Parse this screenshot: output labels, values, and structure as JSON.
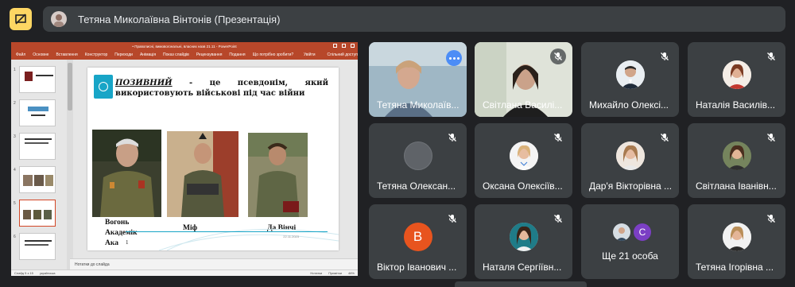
{
  "header": {
    "title": "Тетяна Миколаївна Вінтонів (Презентація)"
  },
  "presentation": {
    "window_title": "• Правописні, вимовогональні, власних назв 21.11 - PowerPoint",
    "ribbon_tabs": [
      "Файл",
      "Основне",
      "Вставлення",
      "Конструктор",
      "Переходи",
      "Анімація",
      "Показ слайдів",
      "Рецензування",
      "Подання",
      "Що потрібно зробити?"
    ],
    "ribbon_right": [
      "Увійти",
      "Спільний доступ"
    ],
    "thumb_numbers": [
      "1",
      "2",
      "3",
      "4",
      "5",
      "6"
    ],
    "slide": {
      "keyword": "ПОЗИВНИЙ",
      "text": " - це псевдонім, який використовують військові під час війни",
      "captions": [
        "Вогонь",
        "Академік",
        "Ака",
        "Міф",
        "Да Вінчі"
      ],
      "page_marker": "1",
      "date": "22.11.2023"
    },
    "notes_placeholder": "Нотатки до слайда",
    "status_left": [
      "Слайд 5 з 15",
      "українська"
    ],
    "status_right": [
      "Нотатки",
      "Примітки",
      "46%"
    ]
  },
  "participants": [
    {
      "name": "Тетяна Миколаїв...",
      "kind": "video",
      "muted": false
    },
    {
      "name": "Світлана Василі...",
      "kind": "video",
      "muted": true
    },
    {
      "name": "Михайло Олексі...",
      "kind": "photo",
      "muted": true
    },
    {
      "name": "Наталія Василів...",
      "kind": "photo",
      "muted": true
    },
    {
      "name": "Тетяна Олексан...",
      "kind": "blank",
      "muted": true
    },
    {
      "name": "Оксана Олексіїв...",
      "kind": "photo",
      "muted": true
    },
    {
      "name": "Дар'я Вікторівна ...",
      "kind": "photo",
      "muted": true
    },
    {
      "name": "Світлана Іванівн...",
      "kind": "photo",
      "muted": true
    },
    {
      "name": "Віктор Іванович ...",
      "kind": "letter",
      "letter": "В",
      "muted": true
    },
    {
      "name": "Наталя Сергіївн...",
      "kind": "photo",
      "muted": true
    },
    {
      "name": "Ще 21 особа",
      "kind": "group",
      "letter": "C",
      "muted": false
    },
    {
      "name": "Тетяна Ігорівна ...",
      "kind": "photo",
      "muted": true
    }
  ],
  "colors": {
    "background": "#202124",
    "tile": "#3c4043",
    "present_button": "#fdd663",
    "accent_blue": "#4c8df6",
    "letter_avatar_v": "#e8541e",
    "letter_avatar_c": "#7b3fc4",
    "ppt_red": "#b7472a"
  },
  "icons": {
    "present_button": "stop-presenting-icon",
    "mute": "mic-off-icon",
    "more": "more-options-icon"
  }
}
